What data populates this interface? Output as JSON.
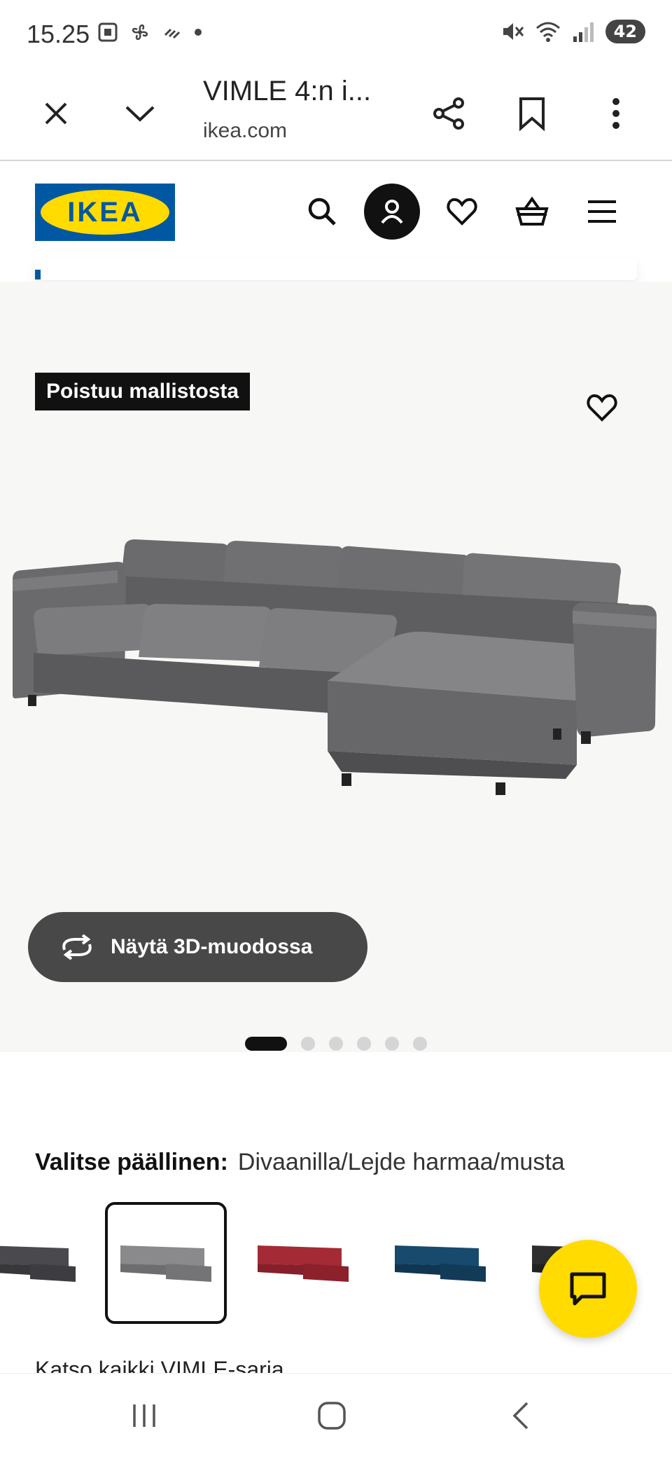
{
  "status_bar": {
    "time": "15.25",
    "battery": "42"
  },
  "browser": {
    "title": "VIMLE 4:n i...",
    "url": "ikea.com"
  },
  "ikea": {
    "logo_text": "IKEA"
  },
  "product": {
    "badge": "Poistuu mallistosta",
    "view_3d_label": "Näytä 3D-muodossa",
    "carousel": {
      "total": 6,
      "active": 1
    }
  },
  "cover": {
    "label": "Valitse päällinen:",
    "value": "Divaanilla/Lejde harmaa/musta",
    "swatches": [
      {
        "name": "dark-grey",
        "color": "#4a4a4e",
        "selected": false
      },
      {
        "name": "lejde-grey-black",
        "color": "#808083",
        "selected": true
      },
      {
        "name": "red",
        "color": "#a42a35",
        "selected": false
      },
      {
        "name": "dark-blue",
        "color": "#143f5e",
        "selected": false
      },
      {
        "name": "black",
        "color": "#2a2a2a",
        "selected": false
      }
    ],
    "see_all": "Katso kaikki VIMLE-sarja"
  },
  "colors": {
    "ikea_blue": "#0058a3",
    "ikea_yellow": "#ffdb00"
  }
}
